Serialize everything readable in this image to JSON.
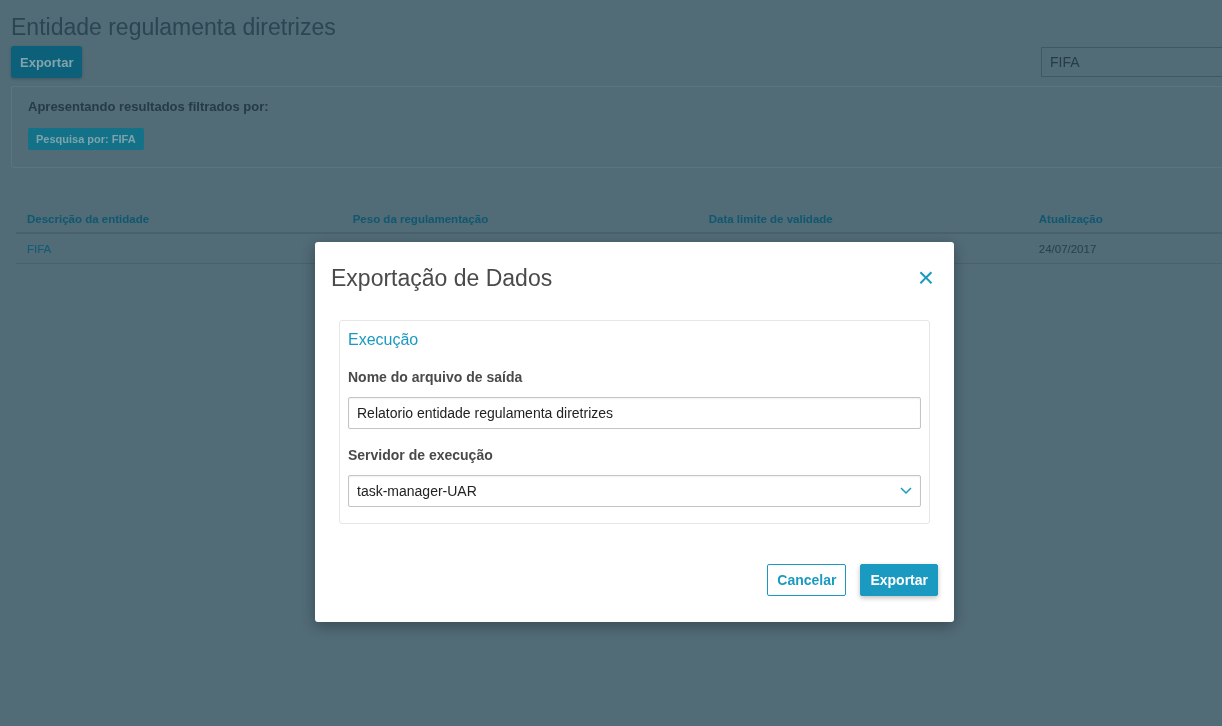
{
  "page": {
    "title": "Entidade regulamenta diretrizes",
    "export_button": "Exportar",
    "search": {
      "value": "FIFA"
    }
  },
  "filters": {
    "heading": "Apresentando resultados filtrados por:",
    "chips": [
      "Pesquisa por: FIFA"
    ]
  },
  "table": {
    "columns": [
      "Descrição da entidade",
      "Peso da regulamentação",
      "Data limite de validade",
      "Atualização"
    ],
    "rows": [
      [
        "FIFA",
        "",
        "",
        "24/07/2017"
      ]
    ]
  },
  "dialog": {
    "title": "Exportação de Dados",
    "close": "×",
    "section": {
      "legend": "Execução",
      "fields": [
        {
          "kind": "text",
          "label": "Nome do arquivo de saída",
          "value": "Relatorio entidade regulamenta diretrizes"
        },
        {
          "kind": "select",
          "label": "Servidor de execução",
          "value": "task-manager-UAR"
        }
      ]
    },
    "buttons": [
      {
        "kind": "secondary",
        "label": "Cancelar"
      },
      {
        "kind": "primary",
        "label": "Exportar"
      }
    ]
  }
}
